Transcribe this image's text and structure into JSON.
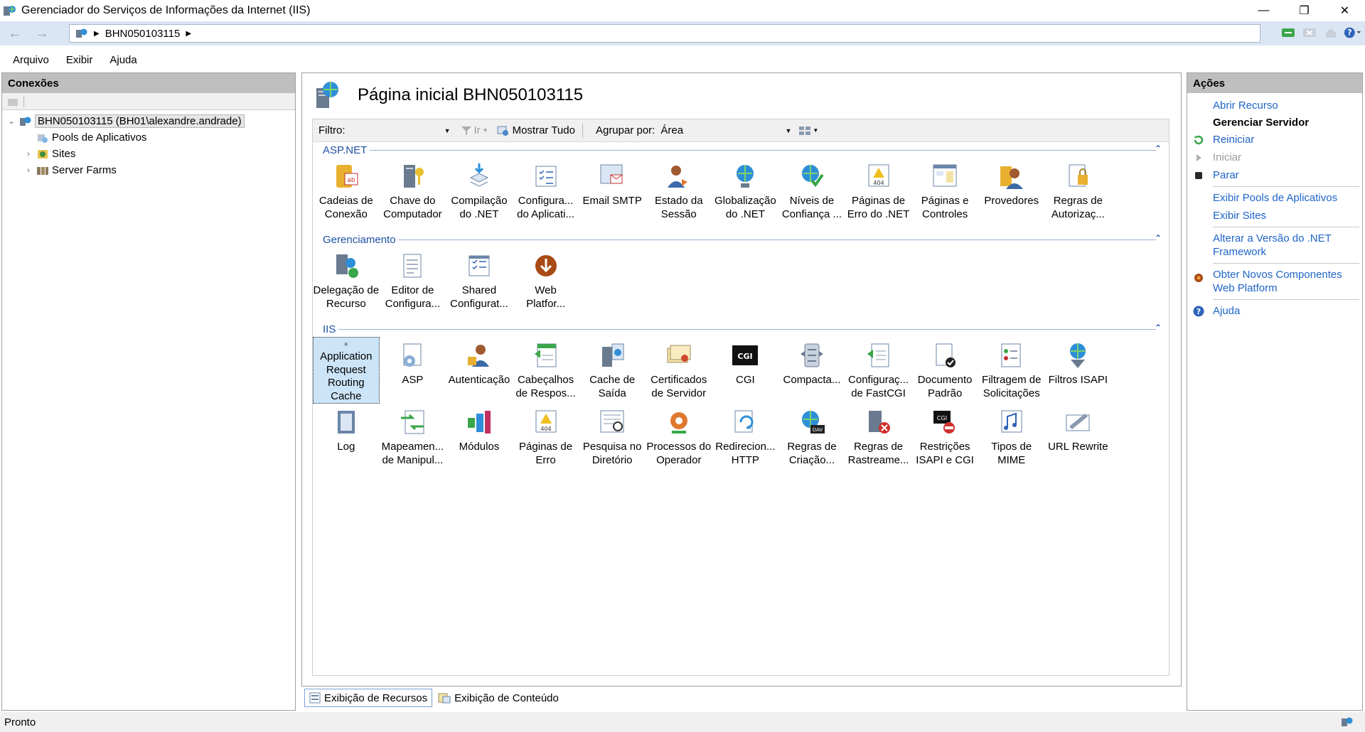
{
  "window": {
    "title": "Gerenciador do Serviços de Informações da Internet (IIS)",
    "minimize": "—",
    "maximize": "❐",
    "close": "✕"
  },
  "address": {
    "back": "←",
    "forward": "→",
    "server": "BHN050103115",
    "sep1": "▶",
    "sep2": "▶"
  },
  "menu": {
    "file": "Arquivo",
    "view": "Exibir",
    "help": "Ajuda"
  },
  "connections": {
    "header": "Conexões",
    "tree": {
      "root": "BHN050103115 (BH01\\alexandre.andrade)",
      "app_pools": "Pools de Aplicativos",
      "sites": "Sites",
      "server_farms": "Server Farms"
    }
  },
  "main": {
    "title": "Página inicial BHN050103115",
    "filter_label": "Filtro:",
    "go_label": "Ir",
    "show_all_label": "Mostrar Tudo",
    "group_by_label": "Agrupar por:",
    "group_by_value": "Área",
    "groups": {
      "aspnet": {
        "name": "ASP.NET",
        "items": [
          {
            "line1": "Cadeias de",
            "line2": "Conexão"
          },
          {
            "line1": "Chave do",
            "line2": "Computador"
          },
          {
            "line1": "Compilação",
            "line2": "do .NET"
          },
          {
            "line1": "Configura...",
            "line2": "do Aplicati..."
          },
          {
            "line1": "Email SMTP",
            "line2": ""
          },
          {
            "line1": "Estado da",
            "line2": "Sessão"
          },
          {
            "line1": "Globalização",
            "line2": "do .NET"
          },
          {
            "line1": "Níveis de",
            "line2": "Confiança ..."
          },
          {
            "line1": "Páginas de",
            "line2": "Erro do .NET"
          },
          {
            "line1": "Páginas e",
            "line2": "Controles"
          },
          {
            "line1": "Provedores",
            "line2": ""
          },
          {
            "line1": "Regras de",
            "line2": "Autorizaç..."
          }
        ]
      },
      "management": {
        "name": "Gerenciamento",
        "items": [
          {
            "line1": "Delegação de",
            "line2": "Recurso"
          },
          {
            "line1": "Editor de",
            "line2": "Configura..."
          },
          {
            "line1": "Shared",
            "line2": "Configurat..."
          },
          {
            "line1": "Web",
            "line2": "Platfor..."
          }
        ]
      },
      "iis": {
        "name": "IIS",
        "row1": [
          {
            "line1": "Application",
            "line2": "Request",
            "line3": "Routing",
            "line4": "Cache"
          },
          {
            "line1": "ASP",
            "line2": ""
          },
          {
            "line1": "Autenticação",
            "line2": ""
          },
          {
            "line1": "Cabeçalhos",
            "line2": "de Respos..."
          },
          {
            "line1": "Cache de",
            "line2": "Saída"
          },
          {
            "line1": "Certificados",
            "line2": "de Servidor"
          },
          {
            "line1": "CGI",
            "line2": ""
          },
          {
            "line1": "Compacta...",
            "line2": ""
          },
          {
            "line1": "Configuraç...",
            "line2": "de FastCGI"
          },
          {
            "line1": "Documento",
            "line2": "Padrão"
          },
          {
            "line1": "Filtragem de",
            "line2": "Solicitações"
          },
          {
            "line1": "Filtros ISAPI",
            "line2": ""
          }
        ],
        "row2": [
          {
            "line1": "Log",
            "line2": ""
          },
          {
            "line1": "Mapeamen...",
            "line2": "de Manipul..."
          },
          {
            "line1": "Módulos",
            "line2": ""
          },
          {
            "line1": "Páginas de",
            "line2": "Erro"
          },
          {
            "line1": "Pesquisa no",
            "line2": "Diretório"
          },
          {
            "line1": "Processos do",
            "line2": "Operador"
          },
          {
            "line1": "Redirecion...",
            "line2": "HTTP"
          },
          {
            "line1": "Regras de",
            "line2": "Criação..."
          },
          {
            "line1": "Regras de",
            "line2": "Rastreame..."
          },
          {
            "line1": "Restrições",
            "line2": "ISAPI e CGI"
          },
          {
            "line1": "Tipos de",
            "line2": "MIME"
          },
          {
            "line1": "URL Rewrite",
            "line2": ""
          }
        ]
      }
    },
    "view_tabs": {
      "features": "Exibição de Recursos",
      "content": "Exibição de Conteúdo"
    }
  },
  "actions": {
    "header": "Ações",
    "open_feature": "Abrir Recurso",
    "manage_server": "Gerenciar Servidor",
    "restart": "Reiniciar",
    "start": "Iniciar",
    "stop": "Parar",
    "view_app_pools": "Exibir Pools de Aplicativos",
    "view_sites": "Exibir Sites",
    "change_net_l1": "Alterar a Versão do .NET",
    "change_net_l2": "Framework",
    "get_components_l1": "Obter Novos Componentes",
    "get_components_l2": "Web Platform",
    "help": "Ajuda"
  },
  "status": {
    "text": "Pronto"
  },
  "colors": {
    "link": "#1e64c8",
    "group_header": "#1e50a2",
    "panel_header": "#bfbfbf",
    "address_bg": "#dbe6f4",
    "selection": "#cce4f7"
  }
}
